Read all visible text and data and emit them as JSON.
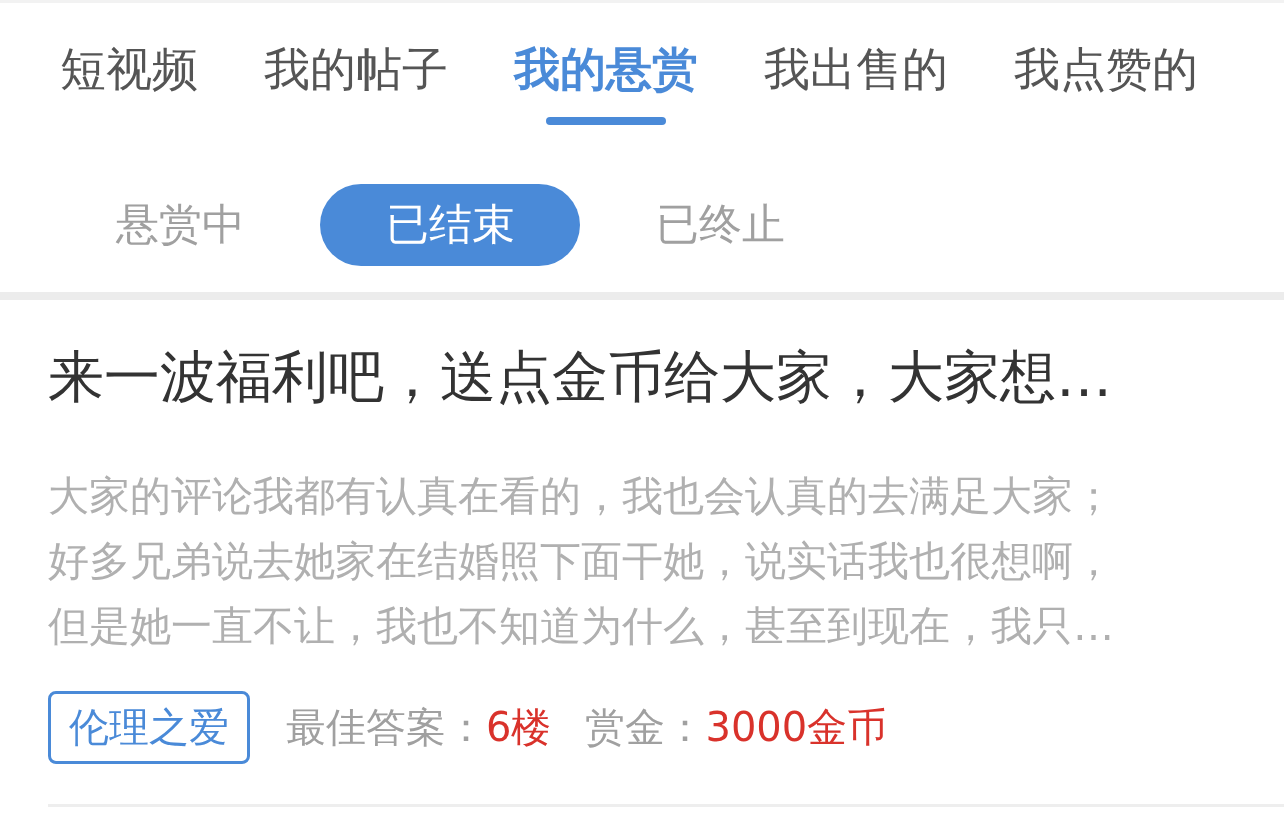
{
  "tabs": [
    {
      "label": "短视频",
      "selected": false
    },
    {
      "label": "我的帖子",
      "selected": false
    },
    {
      "label": "我的悬赏",
      "selected": true
    },
    {
      "label": "我出售的",
      "selected": false
    },
    {
      "label": "我点赞的",
      "selected": false
    }
  ],
  "filters": [
    {
      "label": "悬赏中",
      "selected": false
    },
    {
      "label": "已结束",
      "selected": true
    },
    {
      "label": "已终止",
      "selected": false
    }
  ],
  "posts": [
    {
      "title": "来一波福利吧，送点金币给大家，大家想…",
      "excerpt": "大家的评论我都有认真在看的，我也会认真的去满足大家；好多兄弟说去她家在结婚照下面干她，说实话我也很想啊，但是她一直不让，我也不知道为什么，甚至到现在，我只…",
      "tag": "伦理之爱",
      "best_answer_label": "最佳答案：",
      "best_answer": "6楼",
      "reward_label": "赏金：",
      "reward": "3000金币"
    }
  ]
}
